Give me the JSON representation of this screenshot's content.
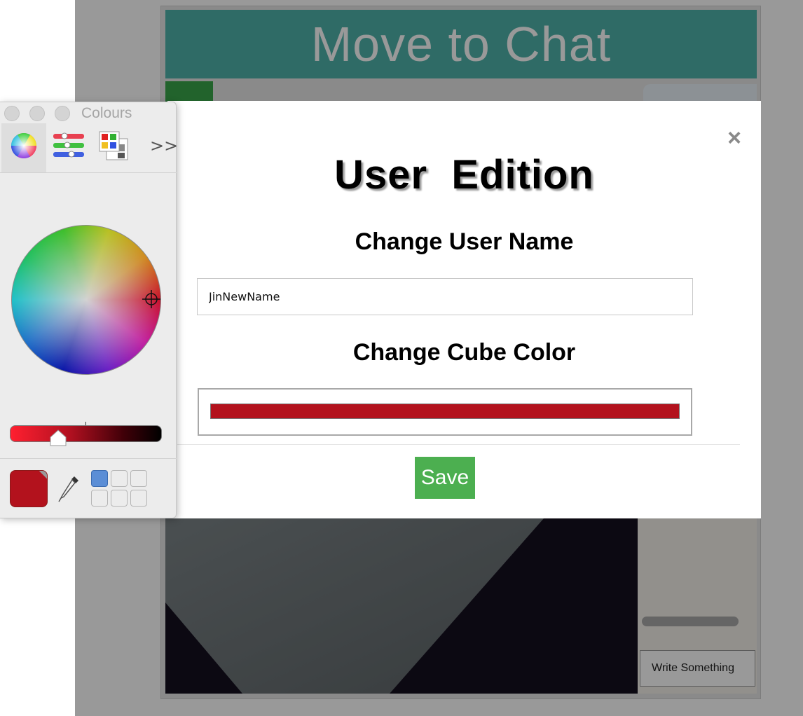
{
  "app": {
    "header_title": "Move to Chat",
    "chat_input_placeholder": "Write Something"
  },
  "modal": {
    "close_label": "×",
    "title": "User  Edition",
    "name_heading": "Change User Name",
    "name_value": "JinNewName",
    "color_heading": "Change Cube Color",
    "color_value": "#b3121d",
    "save_label": "Save"
  },
  "colours_panel": {
    "title": "Colours",
    "more_label": ">>",
    "modes": [
      "color-wheel-icon",
      "sliders-icon",
      "palettes-icon"
    ],
    "selected_color": "#b3121d"
  },
  "colors": {
    "header_teal": "#4fb3aa",
    "save_green": "#4caf50",
    "cube_red": "#b3121d"
  }
}
